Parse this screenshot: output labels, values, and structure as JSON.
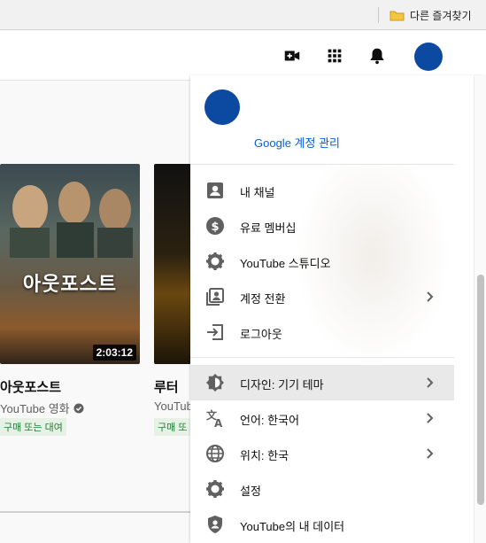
{
  "browser": {
    "bookmark_folder_label": "다른 즐겨찾기",
    "folder_color": "#f5c542"
  },
  "topbar": {
    "icons": [
      "video-create-icon",
      "apps-grid-icon",
      "notifications-bell-icon"
    ],
    "avatar_color": "#0b4aa0"
  },
  "videos": [
    {
      "title": "아웃포스트",
      "thumbnail_text": "아웃포스트",
      "duration": "2:03:12",
      "channel": "YouTube 영화",
      "badge": "구매 또는 대여",
      "verified": true
    },
    {
      "title": "루터",
      "channel": "YouTub",
      "badge": "구매 또"
    }
  ],
  "account_menu": {
    "manage_link": "Google 계정 관리",
    "sections": [
      [
        {
          "icon": "person-icon",
          "label": "내 채널",
          "has_submenu": false
        },
        {
          "icon": "paid-membership-icon",
          "label": "유료 멤버십",
          "has_submenu": false
        },
        {
          "icon": "studio-gear-icon",
          "label": "YouTube 스튜디오",
          "has_submenu": false
        },
        {
          "icon": "switch-account-icon",
          "label": "계정 전환",
          "has_submenu": true
        },
        {
          "icon": "sign-out-icon",
          "label": "로그아웃",
          "has_submenu": false
        }
      ],
      [
        {
          "icon": "theme-icon",
          "label": "디자인: 기기 테마",
          "has_submenu": true,
          "highlighted": true
        },
        {
          "icon": "translate-icon",
          "label": "언어: 한국어",
          "has_submenu": true
        },
        {
          "icon": "globe-icon",
          "label": "위치: 한국",
          "has_submenu": true
        },
        {
          "icon": "settings-gear-icon",
          "label": "설정",
          "has_submenu": false
        },
        {
          "icon": "your-data-shield-icon",
          "label": "YouTube의 내 데이터",
          "has_submenu": false
        }
      ]
    ]
  },
  "colors": {
    "link_blue": "#065fd4",
    "badge_green": "#1e7e34",
    "icon_gray": "#606060"
  }
}
